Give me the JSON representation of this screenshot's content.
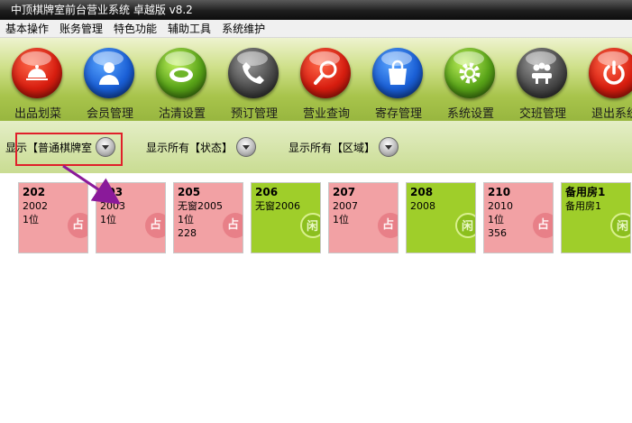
{
  "window": {
    "title": "中顶棋牌室前台营业系统 卓越版 v8.2"
  },
  "menu": [
    "基本操作",
    "账务管理",
    "特色功能",
    "辅助工具",
    "系统维护"
  ],
  "toolbar": [
    {
      "label": "出品划菜",
      "icon": "food-cloche-icon",
      "color": "red"
    },
    {
      "label": "会员管理",
      "icon": "member-user-icon",
      "color": "blue"
    },
    {
      "label": "沽清设置",
      "icon": "plate-icon",
      "color": "green"
    },
    {
      "label": "预订管理",
      "icon": "phone-icon",
      "color": "gray"
    },
    {
      "label": "营业查询",
      "icon": "magnifier-icon",
      "color": "red"
    },
    {
      "label": "寄存管理",
      "icon": "bag-icon",
      "color": "blue"
    },
    {
      "label": "系统设置",
      "icon": "gear-icon",
      "color": "green"
    },
    {
      "label": "交班管理",
      "icon": "meeting-icon",
      "color": "gray"
    },
    {
      "label": "退出系统",
      "icon": "power-icon",
      "color": "red"
    }
  ],
  "filters": {
    "type": "显示【普通棋牌室",
    "status": "显示所有【状态】",
    "area": "显示所有【区域】"
  },
  "colors": {
    "busy": "#f2a1a4",
    "free": "#9fce2a",
    "highlight": "#e0202a",
    "arrow": "#8a1a9a"
  },
  "rooms": [
    {
      "number": "202",
      "name": "2002",
      "seats": "1位",
      "amount": "",
      "badge": "占",
      "state": "busy"
    },
    {
      "number": "203",
      "name": "2003",
      "seats": "1位",
      "amount": "",
      "badge": "占",
      "state": "busy"
    },
    {
      "number": "205",
      "name": "无窗2005",
      "seats": "1位",
      "amount": "228",
      "badge": "占",
      "state": "busy"
    },
    {
      "number": "206",
      "name": "无窗2006",
      "seats": "",
      "amount": "",
      "badge": "闲",
      "state": "free"
    },
    {
      "number": "207",
      "name": "2007",
      "seats": "1位",
      "amount": "",
      "badge": "占",
      "state": "busy"
    },
    {
      "number": "208",
      "name": "2008",
      "seats": "",
      "amount": "",
      "badge": "闲",
      "state": "free"
    },
    {
      "number": "210",
      "name": "2010",
      "seats": "1位",
      "amount": "356",
      "badge": "占",
      "state": "busy"
    },
    {
      "number": "备用房1",
      "name": "备用房1",
      "seats": "",
      "amount": "",
      "badge": "闲",
      "state": "free"
    }
  ]
}
